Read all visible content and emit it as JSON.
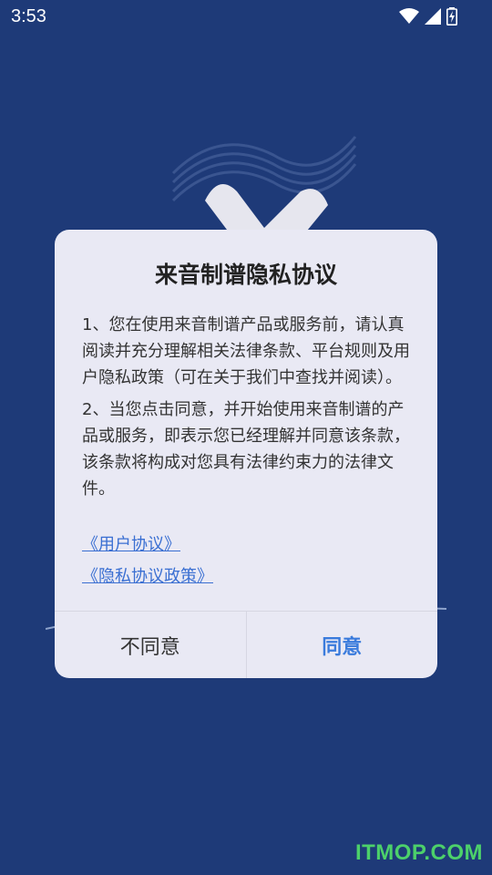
{
  "status_bar": {
    "time": "3:53"
  },
  "dialog": {
    "title": "来音制谱隐私协议",
    "paragraphs": [
      "1、您在使用来音制谱产品或服务前，请认真阅读并充分理解相关法律条款、平台规则及用户隐私政策（可在关于我们中查找并阅读）。",
      "2、当您点击同意，并开始使用来音制谱的产品或服务，即表示您已经理解并同意该条款，该条款将构成对您具有法律约束力的法律文件。"
    ],
    "links": [
      "《用户协议》",
      "《隐私协议政策》"
    ],
    "buttons": {
      "disagree": "不同意",
      "agree": "同意"
    }
  },
  "watermark": "ITMOP.COM",
  "colors": {
    "background": "#1e3a78",
    "dialog_bg": "#e9e9f4",
    "link": "#3a6fd2",
    "agree": "#3a7bdc",
    "watermark": "#4cd06a"
  },
  "icons": [
    "wifi-icon",
    "cellular-signal-icon",
    "battery-charging-icon"
  ]
}
